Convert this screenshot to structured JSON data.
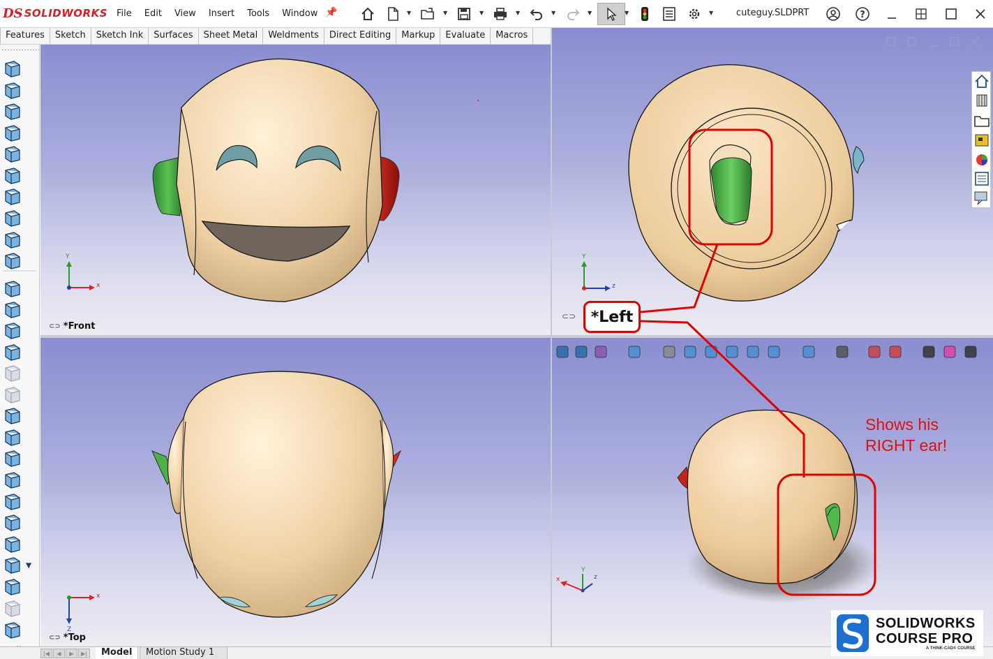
{
  "app": {
    "brand_mark": "DS",
    "brand_name": "SOLIDWORKS",
    "document_title": "cuteguy.SLDPRT"
  },
  "menu": [
    "File",
    "Edit",
    "View",
    "Insert",
    "Tools",
    "Window"
  ],
  "command_tabs": [
    "Features",
    "Sketch",
    "Sketch Ink",
    "Surfaces",
    "Sheet Metal",
    "Weldments",
    "Direct Editing",
    "Markup",
    "Evaluate",
    "Macros"
  ],
  "viewports": {
    "front": {
      "label": "*Front",
      "axis_h": "x",
      "axis_v": "Y"
    },
    "left": {
      "label": "*Left",
      "axis_h": "z",
      "axis_v": "Y"
    },
    "top": {
      "label": "*Top",
      "axis_h": "x",
      "axis_v": "Z"
    },
    "iso": {
      "axis_h": "x",
      "axis_v": "Y",
      "axis_d": "z"
    }
  },
  "bottom_tabs": [
    "Model",
    "Motion Study 1"
  ],
  "annotation": {
    "callout": "*Left",
    "note_line1": "Shows his",
    "note_line2": "RIGHT ear!"
  },
  "course_brand": {
    "line1": "SOLIDWORKS",
    "line2": "COURSE PRO",
    "tagline": "A THINK-CAD® COURSE"
  },
  "colors": {
    "accent_red": "#e00000",
    "skin": "#f0d9b5",
    "ear_left": "#3fa43a",
    "ear_right": "#c21d13",
    "viewport_top": "#8a8ed0"
  },
  "icons": [
    "home-icon",
    "new-document-icon",
    "open-folder-icon",
    "save-icon",
    "print-icon",
    "undo-icon",
    "redo-icon",
    "select-cursor-icon",
    "rebuild-icon",
    "file-properties-icon",
    "options-gear-icon",
    "user-icon",
    "help-icon",
    "minimize-icon",
    "restore-icon",
    "maximize-icon",
    "close-icon"
  ]
}
